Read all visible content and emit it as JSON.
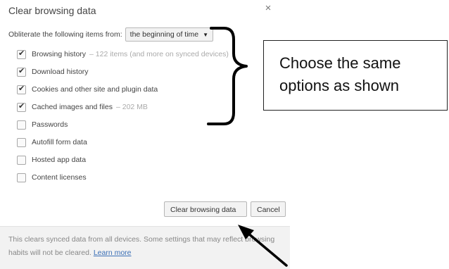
{
  "dialog": {
    "title": "Clear browsing data",
    "close_icon": "×",
    "obliterate_label": "Obliterate the following items from:",
    "time_range_selected": "the beginning of time",
    "options": [
      {
        "label": "Browsing history",
        "extra": "– 122 items (and more on synced devices)",
        "checked": true
      },
      {
        "label": "Download history",
        "extra": "",
        "checked": true
      },
      {
        "label": "Cookies and other site and plugin data",
        "extra": "",
        "checked": true
      },
      {
        "label": "Cached images and files",
        "extra": "– 202 MB",
        "checked": true
      },
      {
        "label": "Passwords",
        "extra": "",
        "checked": false
      },
      {
        "label": "Autofill form data",
        "extra": "",
        "checked": false
      },
      {
        "label": "Hosted app data",
        "extra": "",
        "checked": false
      },
      {
        "label": "Content licenses",
        "extra": "",
        "checked": false
      }
    ],
    "clear_button_label": "Clear browsing data",
    "cancel_button_label": "Cancel",
    "footer_text": "This clears synced data from all devices. Some settings that may reflect browsing habits will not be cleared.",
    "learn_more_label": "Learn more"
  },
  "annotation": {
    "callout_text": "Choose the same options as shown",
    "icons": [
      "right-curly-brace-icon",
      "arrow-icon"
    ]
  }
}
